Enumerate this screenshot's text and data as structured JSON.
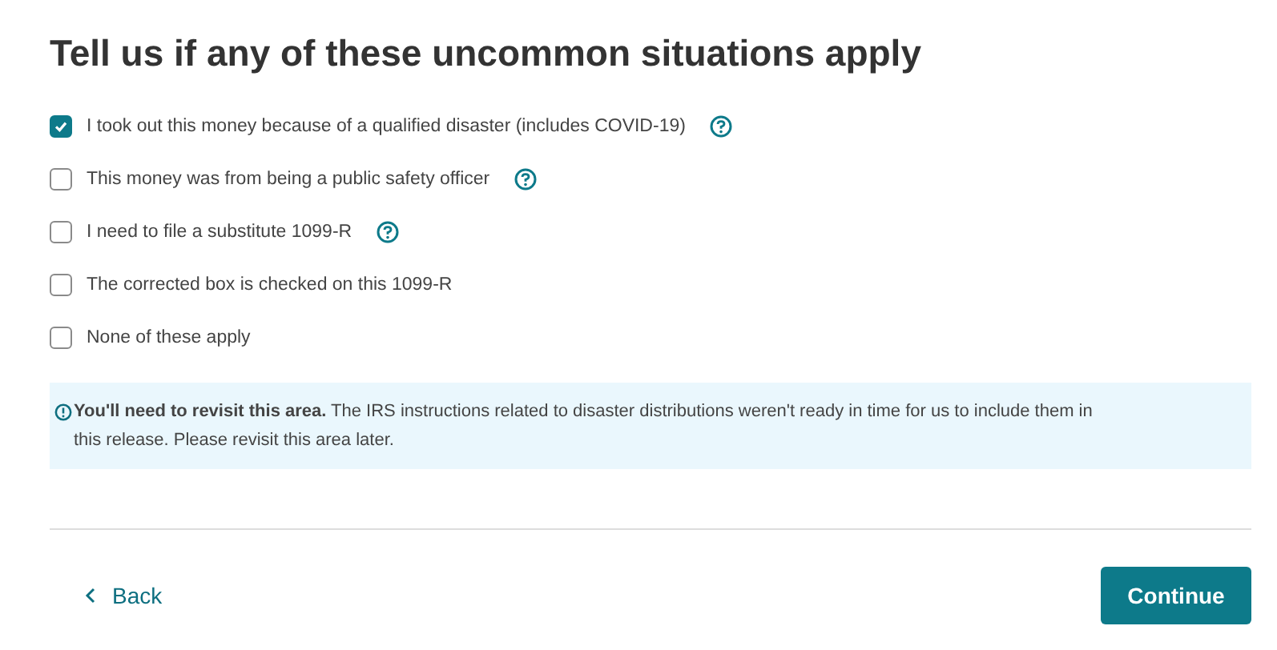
{
  "title": "Tell us if any of these uncommon situations apply",
  "options": [
    {
      "label": "I took out this money because of a qualified disaster (includes COVID-19)",
      "checked": true,
      "help": true
    },
    {
      "label": "This money was from being a public safety officer",
      "checked": false,
      "help": true
    },
    {
      "label": "I need to file a substitute 1099-R",
      "checked": false,
      "help": true
    },
    {
      "label": "The corrected box is checked on this 1099-R",
      "checked": false,
      "help": false
    },
    {
      "label": "None of these apply",
      "checked": false,
      "help": false
    }
  ],
  "notice": "**You'll need to revisit this area.** The IRS instructions related to disaster distributions weren't ready in time for us to include them in this release. Please revisit this area later.",
  "back_button": "Back",
  "continue_button": "Continue"
}
